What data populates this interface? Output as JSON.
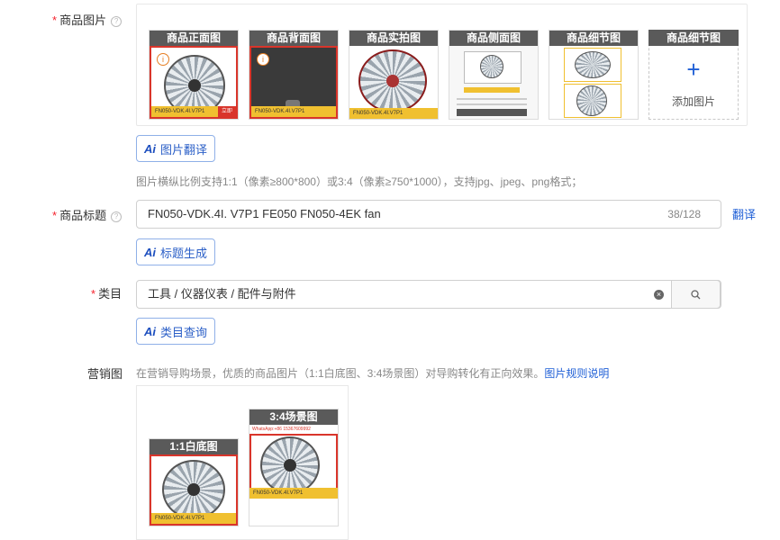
{
  "images": {
    "label": "商品图片",
    "slots": [
      {
        "caption": "商品正面图"
      },
      {
        "caption": "商品背面图"
      },
      {
        "caption": "商品实拍图"
      },
      {
        "caption": "商品侧面图"
      },
      {
        "caption": "商品细节图"
      }
    ],
    "add_slot": {
      "caption": "商品细节图",
      "plus": "+",
      "text": "添加图片"
    },
    "strip_text": "FN050-VDK.4I.V7P1",
    "buy_text": "立即",
    "info_glyph": "i",
    "translate_button": "图片翻译",
    "hint": "图片横纵比例支持1:1（像素≥800*800）或3:4（像素≥750*1000），支持jpg、jpeg、png格式；"
  },
  "title_field": {
    "label": "商品标题",
    "value": "FN050-VDK.4I. V7P1 FE050 FN050-4EK fan",
    "count": "38/128",
    "translate_link": "翻译",
    "generate_button": "标题生成"
  },
  "category_field": {
    "label": "类目",
    "value": "工具 / 仪器仪表 / 配件与附件",
    "query_button": "类目查询"
  },
  "marketing": {
    "label": "营销图",
    "hint": "在营销导购场景，优质的商品图片（1:1白底图、3:4场景图）对导购转化有正向效果。",
    "hint_link": "图片规则说明",
    "slots": [
      {
        "caption": "1:1白底图"
      },
      {
        "caption": "3:4场景图"
      }
    ],
    "whatsapp_text": "WhatsApp:+86 15367609992"
  },
  "ai_mark": "Ai",
  "required_mark": "*",
  "help_glyph": "?",
  "colors": {
    "accent": "#1f5fd6",
    "required": "#f5222d",
    "caption_bg": "#5a5a5a"
  }
}
